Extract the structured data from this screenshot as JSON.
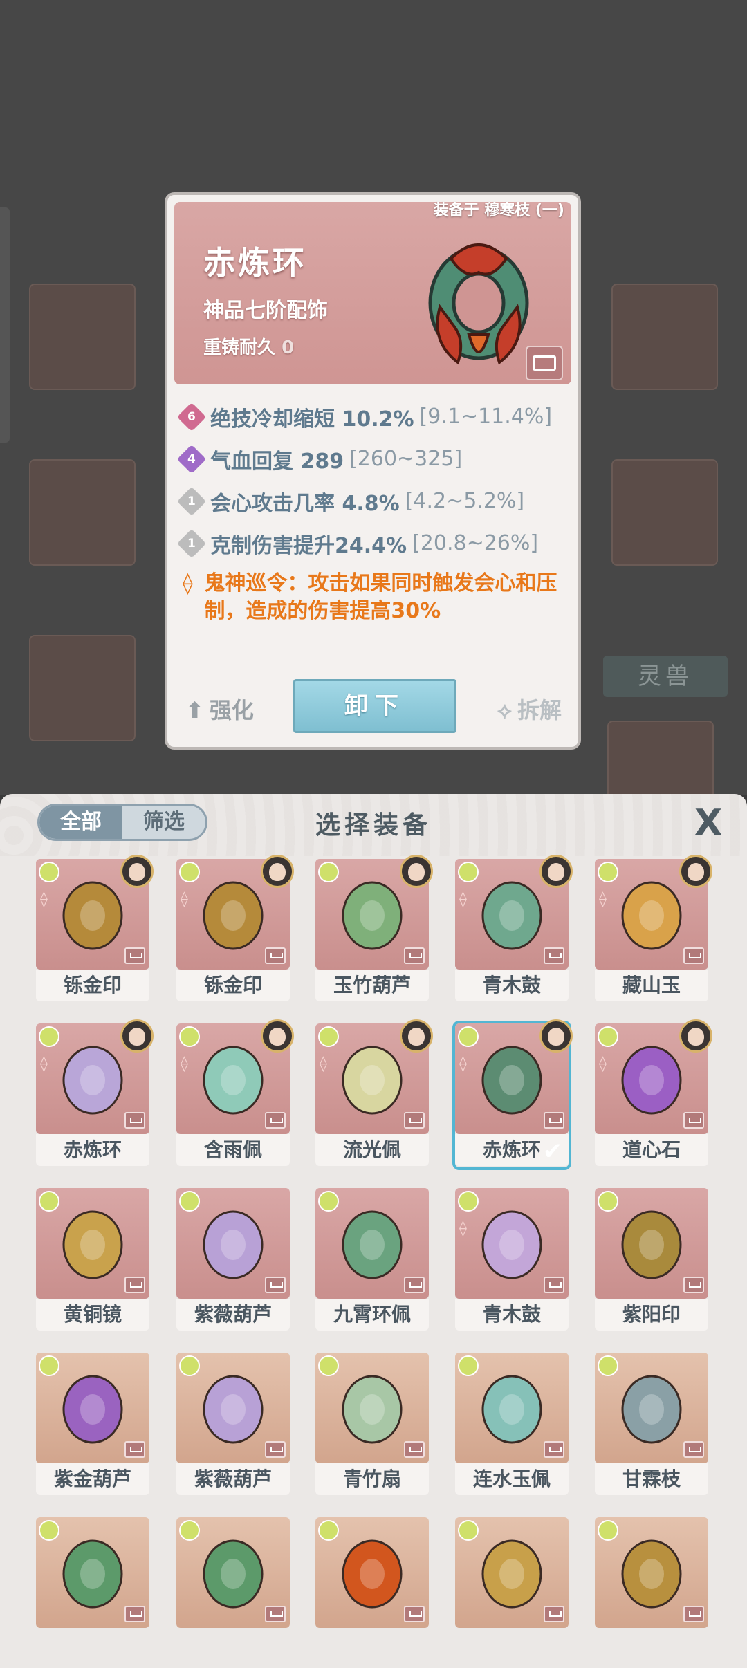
{
  "background": {
    "beast_label": "灵兽"
  },
  "detail": {
    "equipped_on": "装备于 穆寒枝 (一)",
    "name": "赤炼环",
    "grade": "神品七阶配饰",
    "reforge_label": "重铸耐久",
    "reforge_value": "0",
    "stats": [
      {
        "badge": "6",
        "badge_color": "#d06a90",
        "name": "绝技冷却缩短 10.2%",
        "range": "[9.1~11.4%]"
      },
      {
        "badge": "4",
        "badge_color": "#9f6bc8",
        "name": "气血回复 289",
        "range": "[260~325]"
      },
      {
        "badge": "1",
        "badge_color": "#bcbcbc",
        "name": "会心攻击几率 4.8%",
        "range": "[4.2~5.2%]"
      },
      {
        "badge": "1",
        "badge_color": "#bcbcbc",
        "name": "克制伤害提升24.4%",
        "range": "[20.8~26%]"
      }
    ],
    "skill_text": "鬼神巡令：攻击如果同时触发会心和压制，造成的伤害提高30%",
    "actions": {
      "strengthen": "强化",
      "unequip": "卸下",
      "dismantle": "拆解"
    }
  },
  "panel": {
    "tabs": [
      "全部",
      "筛选"
    ],
    "title": "选择装备",
    "close": "X",
    "items": [
      {
        "name": "铄金印",
        "owner": true,
        "set": true
      },
      {
        "name": "铄金印",
        "owner": true,
        "set": true
      },
      {
        "name": "玉竹葫芦",
        "owner": true,
        "set": false
      },
      {
        "name": "青木鼓",
        "owner": true,
        "set": true
      },
      {
        "name": "藏山玉",
        "owner": true,
        "set": true
      },
      {
        "name": "赤炼环",
        "owner": true,
        "set": true
      },
      {
        "name": "含雨佩",
        "owner": true,
        "set": true
      },
      {
        "name": "流光佩",
        "owner": true,
        "set": true
      },
      {
        "name": "赤炼环",
        "owner": true,
        "set": true,
        "selected": true
      },
      {
        "name": "道心石",
        "owner": true,
        "set": true
      },
      {
        "name": "黄铜镜",
        "owner": false,
        "set": false
      },
      {
        "name": "紫薇葫芦",
        "owner": false,
        "set": false
      },
      {
        "name": "九霄环佩",
        "owner": false,
        "set": false
      },
      {
        "name": "青木鼓",
        "owner": false,
        "set": true
      },
      {
        "name": "紫阳印",
        "owner": false,
        "set": false
      },
      {
        "name": "紫金葫芦",
        "owner": false,
        "set": false
      },
      {
        "name": "紫薇葫芦",
        "owner": false,
        "set": false
      },
      {
        "name": "青竹扇",
        "owner": false,
        "set": false
      },
      {
        "name": "连水玉佩",
        "owner": false,
        "set": false
      },
      {
        "name": "甘霖枝",
        "owner": false,
        "set": false
      },
      {
        "name": "",
        "owner": false,
        "set": false
      },
      {
        "name": "",
        "owner": false,
        "set": false
      },
      {
        "name": "",
        "owner": false,
        "set": false
      },
      {
        "name": "",
        "owner": false,
        "set": false
      },
      {
        "name": "",
        "owner": false,
        "set": false
      }
    ]
  },
  "icons": {
    "set_icon": "yin-yang-diamond-icon",
    "check": "✔"
  }
}
